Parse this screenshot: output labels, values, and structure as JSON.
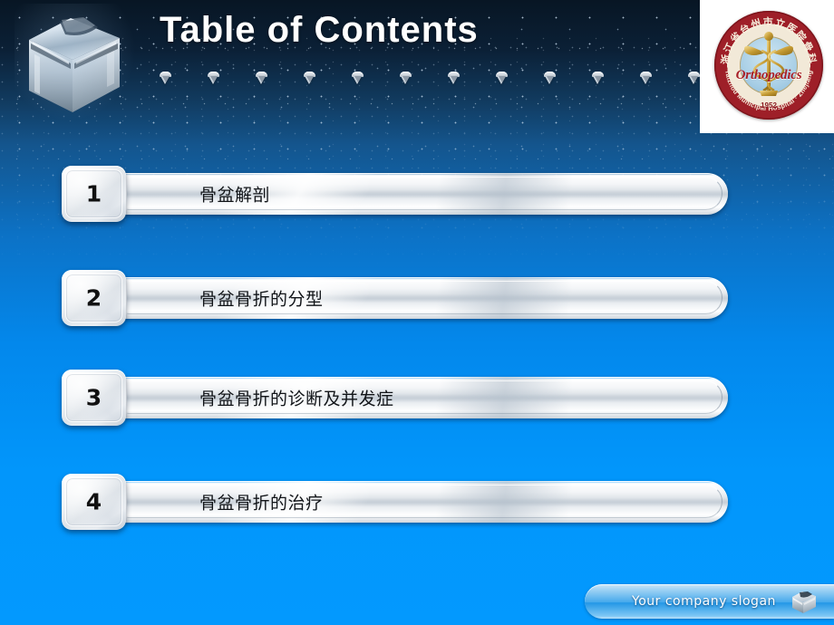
{
  "slide": {
    "title": "Table of Contents",
    "type": "presentation-slide",
    "background": {
      "top_color": "#081624",
      "mid_color": "#14558d",
      "bottom_color": "#0399fe"
    }
  },
  "header": {
    "title": "Table of Contents",
    "cube_icon": "chrome-cube-icon",
    "gem_count": 12,
    "gem_icon": "diamond-gem-icon"
  },
  "logo": {
    "name": "hospital-orthopedics-logo",
    "word": "Orthopedics",
    "year": "1952",
    "english_ring": "Taizhou Municipal Hospital · Zhejiang",
    "chinese_ring": "浙江省台州市立医院骨科",
    "ring_color": "#9e1f28",
    "word_color": "#a81f27"
  },
  "contents": {
    "items": [
      {
        "number": "1",
        "label": "骨盆解剖"
      },
      {
        "number": "2",
        "label": "骨盆骨折的分型"
      },
      {
        "number": "3",
        "label": "骨盆骨折的诊断及并发症"
      },
      {
        "number": "4",
        "label": "骨盆骨折的治疗"
      }
    ]
  },
  "footer": {
    "slogan": "Your company slogan",
    "cube_icon": "chrome-cube-icon",
    "accent_color": "#2397e6"
  }
}
